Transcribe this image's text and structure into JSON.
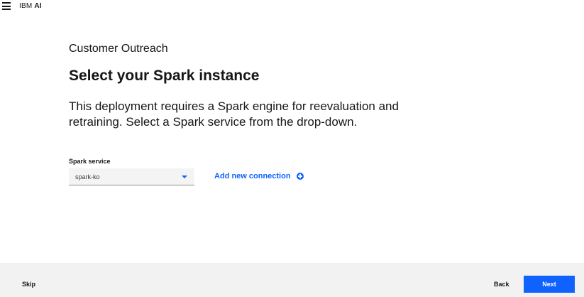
{
  "header": {
    "brand_prefix": "IBM",
    "brand_suffix": "AI"
  },
  "main": {
    "project_name": "Customer Outreach",
    "title": "Select your Spark instance",
    "description": "This deployment requires a Spark engine for reevaluation and retraining. Select a Spark service from the drop-down.",
    "spark_field": {
      "label": "Spark service",
      "value": "spark-ko"
    },
    "add_connection_label": "Add new connection"
  },
  "footer": {
    "skip_label": "Skip",
    "back_label": "Back",
    "next_label": "Next"
  },
  "colors": {
    "accent": "#0f62fe",
    "footer_bg": "#f2f2f2",
    "field_bg": "#f4f4f4"
  },
  "icons": {
    "menu": "hamburger-icon",
    "dropdown": "chevron-down-icon",
    "add": "add-circle-icon"
  }
}
